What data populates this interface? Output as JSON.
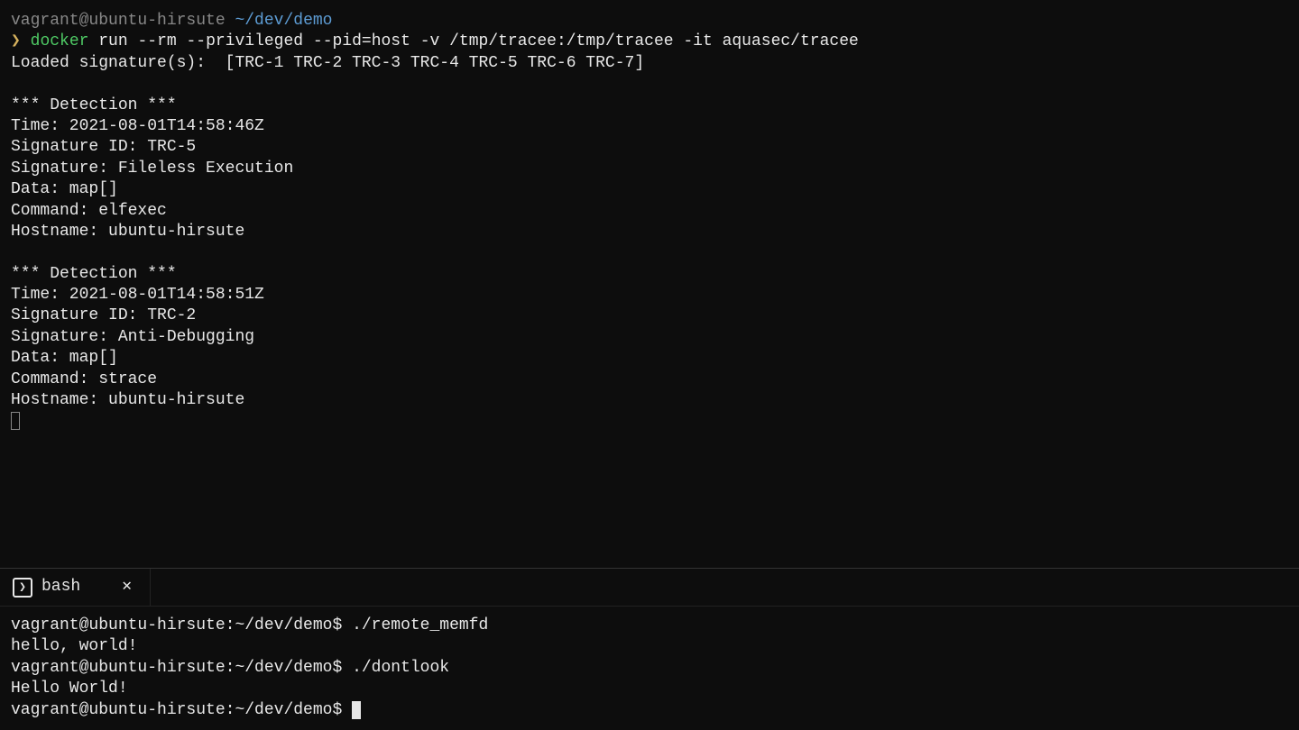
{
  "top": {
    "prompt_user": "vagrant@ubuntu-hirsute ",
    "prompt_path": "~/dev/demo",
    "prompt_arrow": "❯ ",
    "cmd_docker": "docker",
    "cmd_rest": " run --rm --privileged --pid=host -v /tmp/tracee:/tmp/tracee -it aquasec/tracee",
    "loaded": "Loaded signature(s):  [TRC-1 TRC-2 TRC-3 TRC-4 TRC-5 TRC-6 TRC-7]",
    "det1_header": "*** Detection ***",
    "det1_time": "Time: 2021-08-01T14:58:46Z",
    "det1_sigid": "Signature ID: TRC-5",
    "det1_sig": "Signature: Fileless Execution",
    "det1_data": "Data: map[]",
    "det1_cmd": "Command: elfexec",
    "det1_host": "Hostname: ubuntu-hirsute",
    "det2_header": "*** Detection ***",
    "det2_time": "Time: 2021-08-01T14:58:51Z",
    "det2_sigid": "Signature ID: TRC-2",
    "det2_sig": "Signature: Anti-Debugging",
    "det2_data": "Data: map[]",
    "det2_cmd": "Command: strace",
    "det2_host": "Hostname: ubuntu-hirsute"
  },
  "tab": {
    "icon_glyph": "❯",
    "label": "bash",
    "close_glyph": "✕"
  },
  "bottom": {
    "p1": "vagrant@ubuntu-hirsute:~/dev/demo$ ",
    "c1": "./remote_memfd",
    "o1": "hello, world!",
    "p2": "vagrant@ubuntu-hirsute:~/dev/demo$ ",
    "c2": "./dontlook",
    "o2": "Hello World!",
    "p3": "vagrant@ubuntu-hirsute:~/dev/demo$ "
  }
}
